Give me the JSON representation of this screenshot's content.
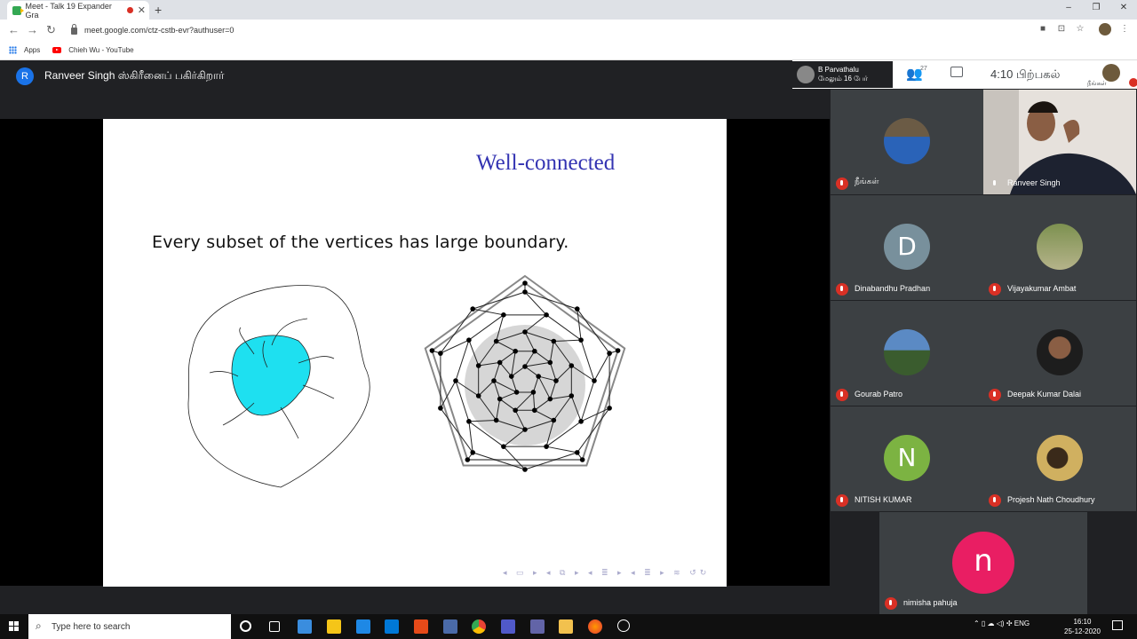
{
  "browser": {
    "tab_title": "Meet - Talk 19 Expander Gra",
    "new_tab": "+",
    "url": "meet.google.com/ctz-cstb-evr?authuser=0",
    "bookmarks": [
      "Apps",
      "Chieh Wu - YouTube"
    ],
    "window_controls": [
      "–",
      "❐",
      "✕"
    ]
  },
  "meet": {
    "presenter_initial": "R",
    "presenter_label": "Ranveer Singh ஸ்கிரீனைப் பகிர்கிறார்",
    "pinned_name": "B Parvathalu",
    "pinned_sub": "மேலும் 16 பேர்",
    "people_count": "27",
    "clock": "4:10 பிற்பகல்",
    "you_label": "நீங்கள்",
    "participants": [
      {
        "name": "நீங்கள்",
        "initial": "",
        "color": "#5a6a7a"
      },
      {
        "name": "Ranveer Singh",
        "initial": "",
        "color": "#d9d4cf"
      },
      {
        "name": "Dinabandhu Pradhan",
        "initial": "D",
        "color": "#78909c"
      },
      {
        "name": "Vijayakumar Ambat",
        "initial": "",
        "color": "#8a9a5b"
      },
      {
        "name": "Gourab Patro",
        "initial": "",
        "color": "#6a8fb0"
      },
      {
        "name": "Deepak Kumar Dalai",
        "initial": "",
        "color": "#2b2b2b"
      },
      {
        "name": "NITISH KUMAR",
        "initial": "N",
        "color": "#7cb342"
      },
      {
        "name": "Projesh Nath Choudhury",
        "initial": "",
        "color": "#b59a54"
      },
      {
        "name": "nimisha pahuja",
        "initial": "n",
        "color": "#e91e63"
      }
    ]
  },
  "slide": {
    "title": "Well-connected",
    "text": "Every subset of the vertices has large boundary.",
    "nav": "◂ ▭ ▸ ◂ ⧉ ▸ ◂ ≣ ▸ ◂ ≣ ▸ ≋ ↺↻"
  },
  "taskbar": {
    "search_placeholder": "Type here to search",
    "lang": "ENG",
    "time": "16:10",
    "date": "25-12-2020"
  }
}
